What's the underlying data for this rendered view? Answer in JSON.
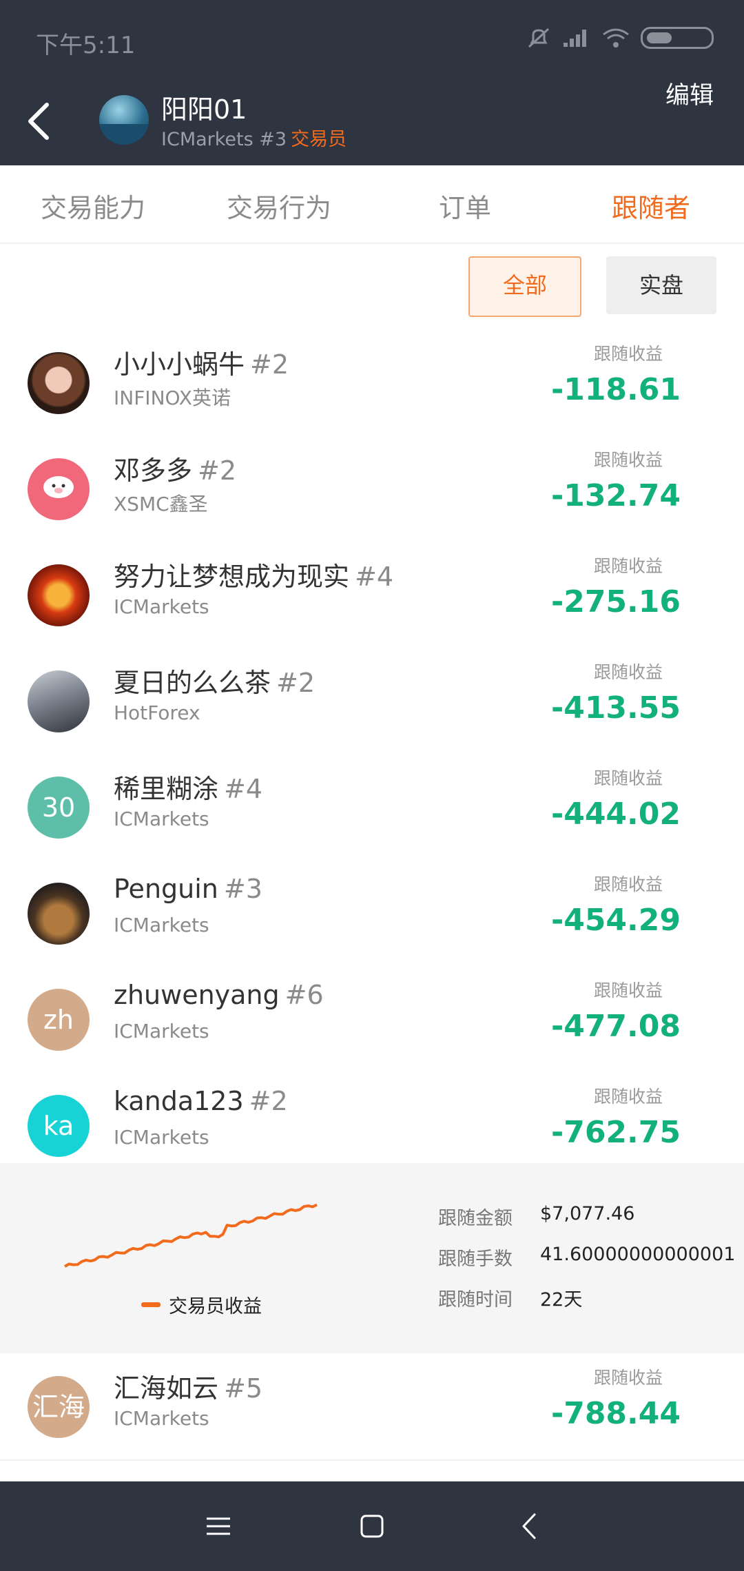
{
  "status_bar": {
    "time": "下午5:11"
  },
  "header": {
    "name": "阳阳01",
    "broker_rank": "ICMarkets #3",
    "role": "交易员",
    "edit_label": "编辑"
  },
  "tabs": [
    {
      "label": "交易能力"
    },
    {
      "label": "交易行为"
    },
    {
      "label": "订单"
    },
    {
      "label": "跟随者"
    }
  ],
  "filters": {
    "all": "全部",
    "real": "实盘"
  },
  "followers": [
    {
      "name": "小小小蜗牛",
      "rank": "#2",
      "broker": "INFINOX英诺",
      "profit_label": "跟随收益",
      "profit": "-118.61",
      "avatar_text": ""
    },
    {
      "name": "邓多多",
      "rank": "#2",
      "broker": "XSMC鑫圣",
      "profit_label": "跟随收益",
      "profit": "-132.74",
      "avatar_text": ""
    },
    {
      "name": "努力让梦想成为现实",
      "rank": "#4",
      "broker": "ICMarkets",
      "profit_label": "跟随收益",
      "profit": "-275.16",
      "avatar_text": ""
    },
    {
      "name": "夏日的么么茶",
      "rank": "#2",
      "broker": "HotForex",
      "profit_label": "跟随收益",
      "profit": "-413.55",
      "avatar_text": ""
    },
    {
      "name": "稀里糊涂",
      "rank": "#4",
      "broker": "ICMarkets",
      "profit_label": "跟随收益",
      "profit": "-444.02",
      "avatar_text": "30"
    },
    {
      "name": "Penguin",
      "rank": "#3",
      "broker": "ICMarkets",
      "profit_label": "跟随收益",
      "profit": "-454.29",
      "avatar_text": ""
    },
    {
      "name": "zhuwenyang",
      "rank": "#6",
      "broker": "ICMarkets",
      "profit_label": "跟随收益",
      "profit": "-477.08",
      "avatar_text": "zh"
    },
    {
      "name": "kanda123",
      "rank": "#2",
      "broker": "ICMarkets",
      "profit_label": "跟随收益",
      "profit": "-762.75",
      "avatar_text": "ka"
    },
    {
      "name": "汇海如云",
      "rank": "#5",
      "broker": "ICMarkets",
      "profit_label": "跟随收益",
      "profit": "-788.44",
      "avatar_text": "汇海"
    }
  ],
  "detail": {
    "legend": "交易员收益",
    "stats": [
      {
        "label": "跟随金额",
        "value": "$7,077.46"
      },
      {
        "label": "跟随手数",
        "value": "41.60000000000001"
      },
      {
        "label": "跟随时间",
        "value": "22天"
      }
    ]
  },
  "colors": {
    "accent": "#f26b1d",
    "profit": "#12b07a",
    "header_bg": "#2e3440"
  }
}
